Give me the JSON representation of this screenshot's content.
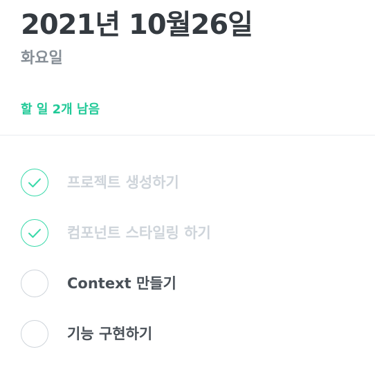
{
  "header": {
    "date": "2021년 10월26일",
    "day": "화요일",
    "tasks_left": "할 일 2개 남음"
  },
  "todos": [
    {
      "text": "프로젝트 생성하기",
      "done": true
    },
    {
      "text": "컴포넌트 스타일링 하기",
      "done": true
    },
    {
      "text": "Context 만들기",
      "done": false
    },
    {
      "text": "기능 구현하기",
      "done": false
    }
  ],
  "colors": {
    "accent": "#38d9a9",
    "tasks_left": "#20c997",
    "title": "#343a40",
    "subtitle": "#868e96",
    "done_text": "#ced4da",
    "todo_text": "#495057"
  },
  "icons": {
    "done": "check-icon"
  }
}
